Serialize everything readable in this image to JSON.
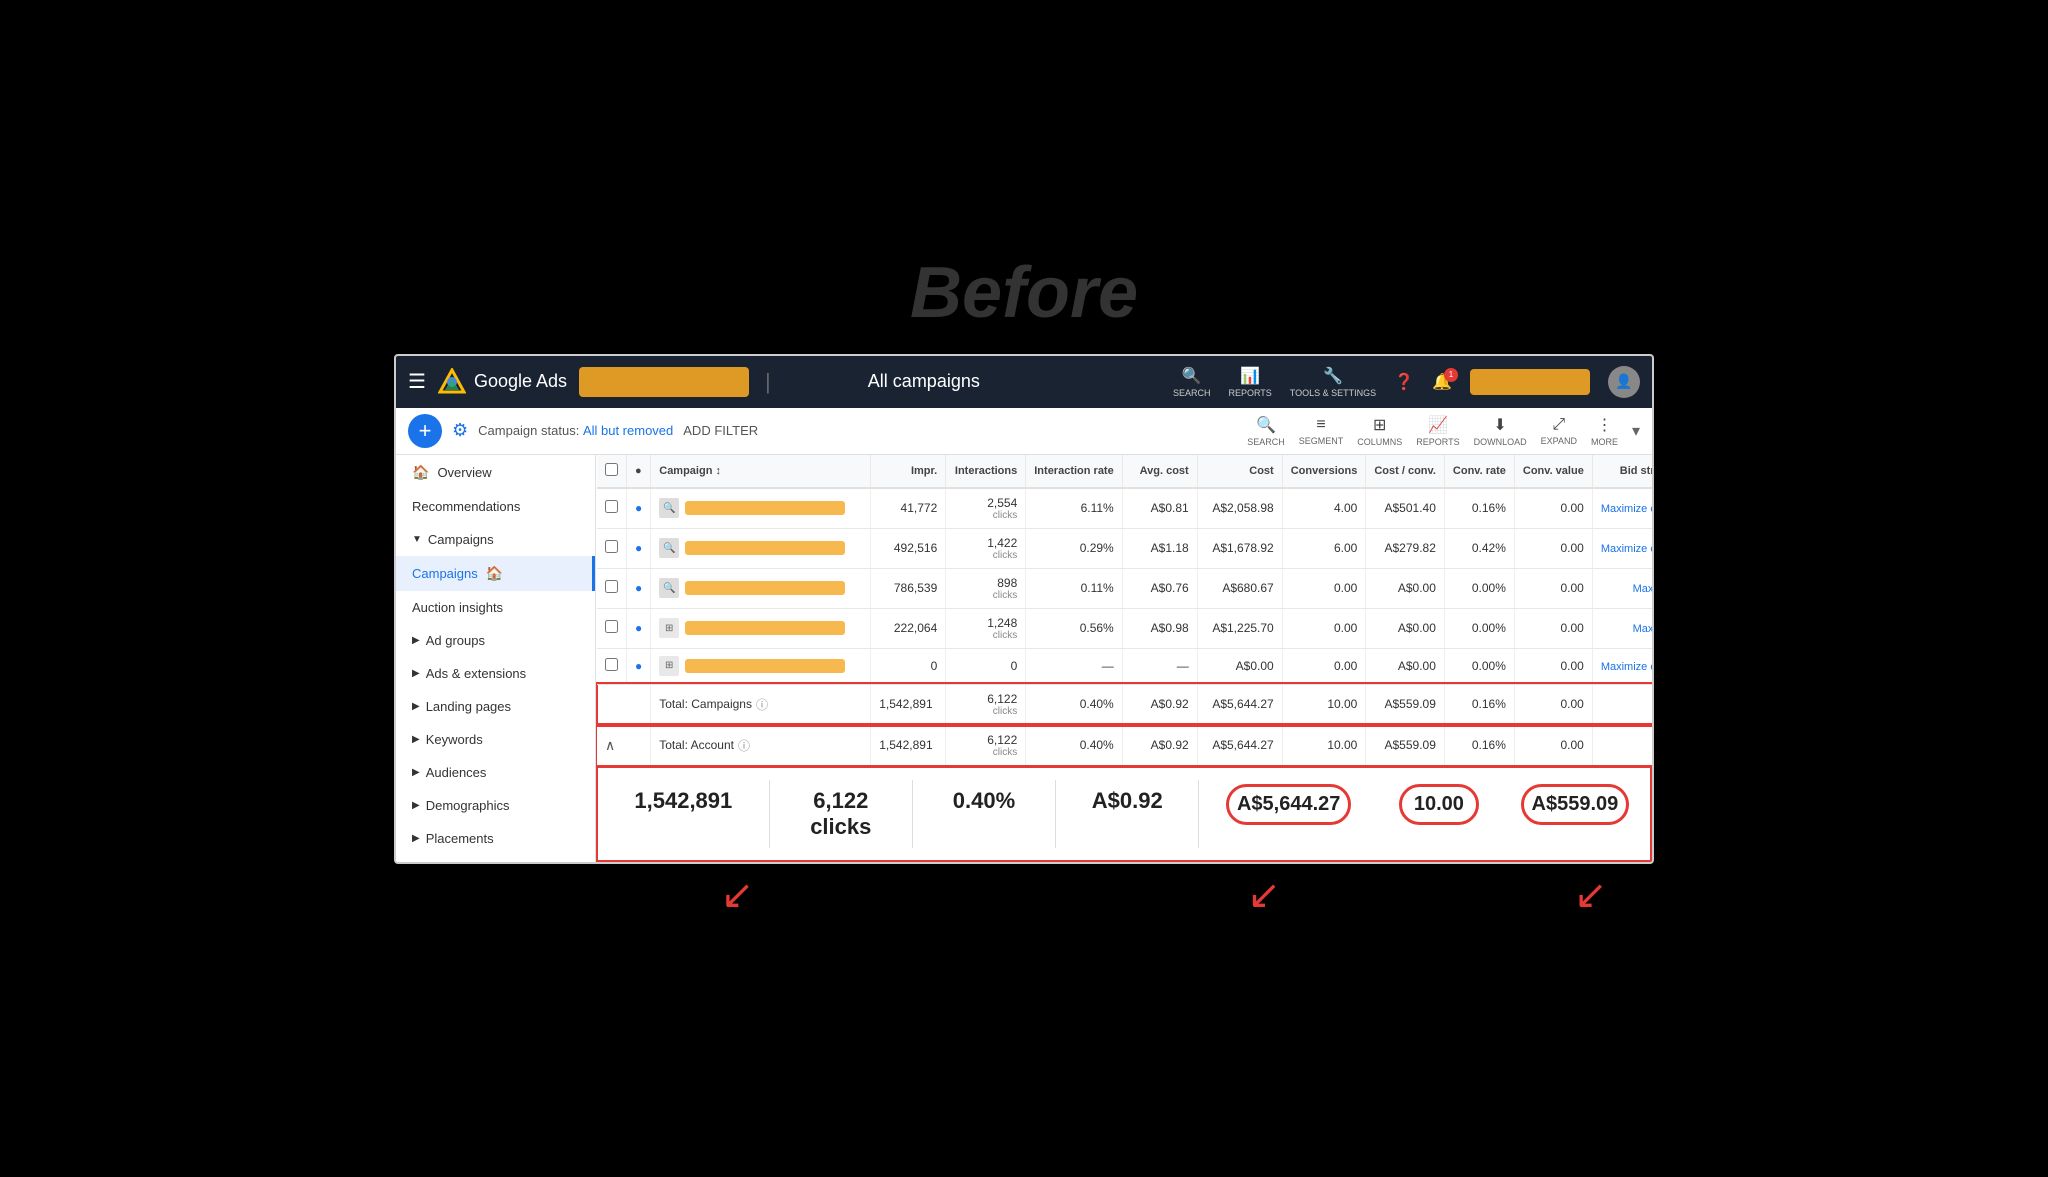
{
  "page": {
    "before_label": "Before",
    "title": "All campaigns"
  },
  "topnav": {
    "app_name": "Google Ads",
    "search_label": "SEARCH",
    "reports_label": "REPORTS",
    "tools_label": "TOOLS & SETTINGS",
    "help_label": "?",
    "notification_count": "1"
  },
  "toolbar": {
    "filter_status": "Campaign status:",
    "filter_value": "All but removed",
    "add_filter": "ADD FILTER",
    "search_label": "SEARCH",
    "segment_label": "SEGMENT",
    "columns_label": "COLUMNS",
    "reports_label": "REPORTS",
    "download_label": "DOWNLOAD",
    "expand_label": "EXPAND",
    "more_label": "MORE"
  },
  "sidebar": {
    "items": [
      {
        "label": "Overview",
        "icon": "🏠",
        "active": false
      },
      {
        "label": "Recommendations",
        "icon": "",
        "active": false
      },
      {
        "label": "Campaigns",
        "icon": "",
        "group": true,
        "active": false
      },
      {
        "label": "Campaigns",
        "icon": "🏠",
        "active": true
      },
      {
        "label": "Auction insights",
        "icon": "",
        "active": false
      },
      {
        "label": "Ad groups",
        "icon": "",
        "group": true,
        "active": false
      },
      {
        "label": "Ads & extensions",
        "icon": "",
        "group": true,
        "active": false
      },
      {
        "label": "Landing pages",
        "icon": "",
        "group": true,
        "active": false
      },
      {
        "label": "Keywords",
        "icon": "",
        "group": true,
        "active": false
      },
      {
        "label": "Audiences",
        "icon": "",
        "group": true,
        "active": false
      },
      {
        "label": "Demographics",
        "icon": "",
        "group": true,
        "active": false
      },
      {
        "label": "Placements",
        "icon": "",
        "group": true,
        "active": false
      }
    ]
  },
  "table": {
    "headers": [
      "",
      "",
      "Campaign",
      "Impr.",
      "Interactions",
      "Interaction rate",
      "Avg. cost",
      "Cost",
      "Conversions",
      "Cost / conv.",
      "Conv. rate",
      "Conv. value",
      "Bid strategy type"
    ],
    "rows": [
      {
        "impr": "41,772",
        "interactions": "2,554",
        "interactions_sub": "clicks",
        "rate": "6.11%",
        "avg_cost": "A$0.81",
        "cost": "A$2,058.98",
        "conversions": "4.00",
        "cost_conv": "A$501.40",
        "conv_rate": "0.16%",
        "conv_value": "0.00",
        "bid_strategy": "Maximize conversions"
      },
      {
        "impr": "492,516",
        "interactions": "1,422",
        "interactions_sub": "clicks",
        "rate": "0.29%",
        "avg_cost": "A$1.18",
        "cost": "A$1,678.92",
        "conversions": "6.00",
        "cost_conv": "A$279.82",
        "conv_rate": "0.42%",
        "conv_value": "0.00",
        "bid_strategy": "Maximize conversions"
      },
      {
        "impr": "786,539",
        "interactions": "898",
        "interactions_sub": "clicks",
        "rate": "0.11%",
        "avg_cost": "A$0.76",
        "cost": "A$680.67",
        "conversions": "0.00",
        "cost_conv": "A$0.00",
        "conv_rate": "0.00%",
        "conv_value": "0.00",
        "bid_strategy": "Maximize clicks"
      },
      {
        "impr": "222,064",
        "interactions": "1,248",
        "interactions_sub": "clicks",
        "rate": "0.56%",
        "avg_cost": "A$0.98",
        "cost": "A$1,225.70",
        "conversions": "0.00",
        "cost_conv": "A$0.00",
        "conv_rate": "0.00%",
        "conv_value": "0.00",
        "bid_strategy": "Maximize clicks"
      },
      {
        "impr": "0",
        "interactions": "0",
        "interactions_sub": "",
        "rate": "—",
        "avg_cost": "—",
        "cost": "A$0.00",
        "conversions": "0.00",
        "cost_conv": "A$0.00",
        "conv_rate": "0.00%",
        "conv_value": "0.00",
        "bid_strategy": "Maximize conversions"
      }
    ],
    "total_campaigns": {
      "label": "Total: Campaigns",
      "impr": "1,542,891",
      "interactions": "6,122",
      "interactions_sub": "clicks",
      "rate": "0.40%",
      "avg_cost": "A$0.92",
      "cost": "A$5,644.27",
      "conversions": "10.00",
      "cost_conv": "A$559.09",
      "conv_rate": "0.16%",
      "conv_value": "0.00"
    },
    "total_account": {
      "label": "Total: Account",
      "impr": "1,542,891",
      "interactions": "6,122",
      "interactions_sub": "clicks",
      "rate": "0.40%",
      "avg_cost": "A$0.92",
      "cost": "A$5,644.27",
      "conversions": "10.00",
      "cost_conv": "A$559.09",
      "conv_rate": "0.16%",
      "conv_value": "0.00"
    }
  },
  "annotation": {
    "impr": "1,542,891",
    "clicks": "6,122\nclicks",
    "rate": "0.40%",
    "avg_cost": "A$0.92",
    "cost": "A$5,644.27",
    "conversions": "10.00",
    "cost_conv": "A$559.09"
  },
  "arrows": {
    "color": "#e53935"
  }
}
